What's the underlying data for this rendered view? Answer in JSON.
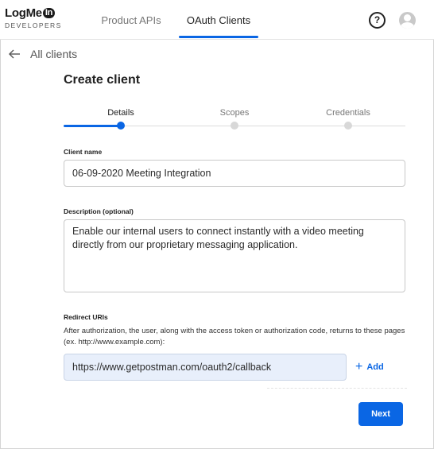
{
  "brand": {
    "name": "LogMe",
    "badge": "In",
    "sub": "DEVELOPERS"
  },
  "nav": {
    "tabs": [
      {
        "label": "Product APIs",
        "active": false
      },
      {
        "label": "OAuth Clients",
        "active": true
      }
    ],
    "help_glyph": "?"
  },
  "back": {
    "label": "All clients",
    "icon": "arrow-left-icon"
  },
  "page": {
    "title": "Create client"
  },
  "stepper": {
    "steps": [
      {
        "label": "Details",
        "active": true
      },
      {
        "label": "Scopes",
        "active": false
      },
      {
        "label": "Credentials",
        "active": false
      }
    ]
  },
  "form": {
    "client_name": {
      "label": "Client name",
      "value": "06-09-2020 Meeting Integration"
    },
    "description": {
      "label": "Description (optional)",
      "value": "Enable our internal users to connect instantly with a video meeting directly from our proprietary messaging application."
    },
    "redirect": {
      "label": "Redirect URIs",
      "help": "After authorization, the user, along with the access token or authorization code, returns to these pages (ex. http://www.example.com):",
      "value": "https://www.getpostman.com/oauth2/callback",
      "add_label": "Add"
    },
    "next_label": "Next"
  },
  "colors": {
    "accent": "#0a66e4",
    "redirect_bg": "#e8effb"
  }
}
